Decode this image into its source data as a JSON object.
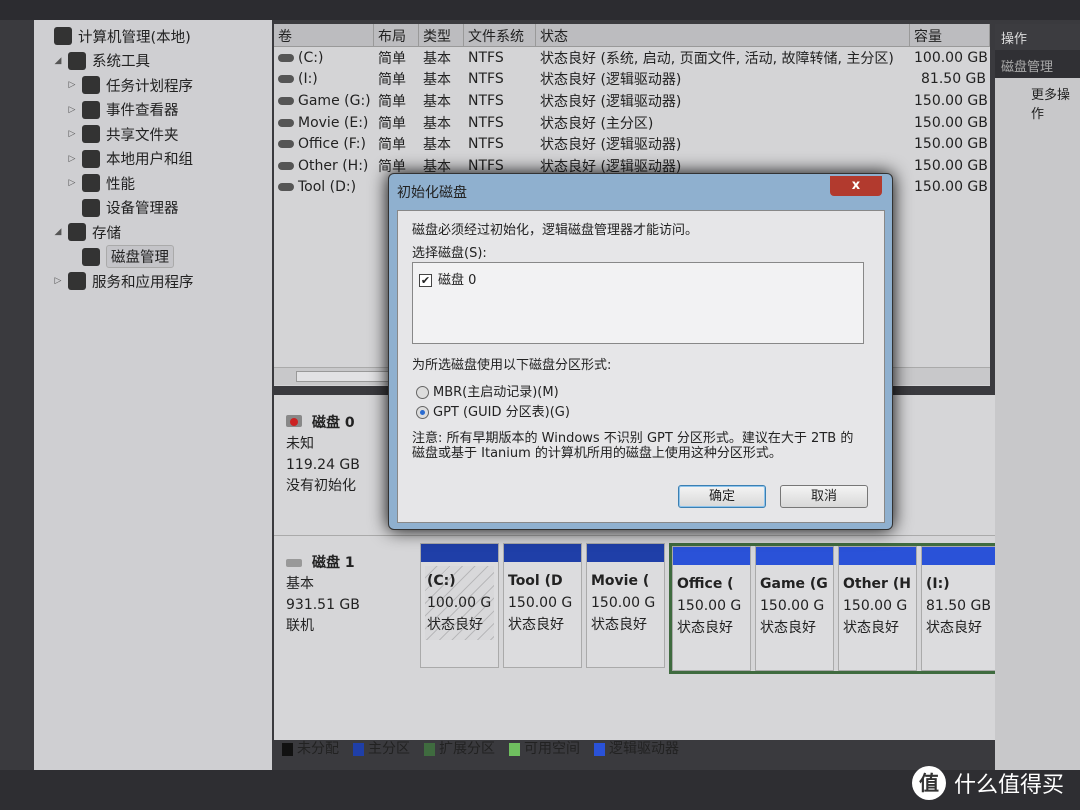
{
  "tree": {
    "items": [
      {
        "label": "计算机管理(本地)",
        "level": 0,
        "arrow": ""
      },
      {
        "label": "系统工具",
        "level": 1,
        "arrow": "expanded"
      },
      {
        "label": "任务计划程序",
        "level": 2,
        "arrow": "collapsed"
      },
      {
        "label": "事件查看器",
        "level": 2,
        "arrow": "collapsed"
      },
      {
        "label": "共享文件夹",
        "level": 2,
        "arrow": "collapsed"
      },
      {
        "label": "本地用户和组",
        "level": 2,
        "arrow": "collapsed"
      },
      {
        "label": "性能",
        "level": 2,
        "arrow": "collapsed"
      },
      {
        "label": "设备管理器",
        "level": 2,
        "arrow": ""
      },
      {
        "label": "存储",
        "level": 1,
        "arrow": "expanded"
      },
      {
        "label": "磁盘管理",
        "level": 2,
        "arrow": "",
        "selected": true
      },
      {
        "label": "服务和应用程序",
        "level": 1,
        "arrow": "collapsed"
      }
    ]
  },
  "volumes": {
    "headers": [
      "卷",
      "布局",
      "类型",
      "文件系统",
      "状态",
      "容量"
    ],
    "rows": [
      [
        "(C:)",
        "简单",
        "基本",
        "NTFS",
        "状态良好 (系统, 启动, 页面文件, 活动, 故障转储, 主分区)",
        "100.00 GB"
      ],
      [
        "(I:)",
        "简单",
        "基本",
        "NTFS",
        "状态良好 (逻辑驱动器)",
        "81.50 GB"
      ],
      [
        "Game (G:)",
        "简单",
        "基本",
        "NTFS",
        "状态良好 (逻辑驱动器)",
        "150.00 GB"
      ],
      [
        "Movie (E:)",
        "简单",
        "基本",
        "NTFS",
        "状态良好 (主分区)",
        "150.00 GB"
      ],
      [
        "Office (F:)",
        "简单",
        "基本",
        "NTFS",
        "状态良好 (逻辑驱动器)",
        "150.00 GB"
      ],
      [
        "Other (H:)",
        "简单",
        "基本",
        "NTFS",
        "状态良好 (逻辑驱动器)",
        "150.00 GB"
      ],
      [
        "Tool (D:)",
        "",
        "",
        "",
        "",
        "150.00 GB"
      ]
    ]
  },
  "disks": [
    {
      "name": "磁盘 0",
      "type": "未知",
      "size": "119.24 GB",
      "state": "没有初始化"
    },
    {
      "name": "磁盘 1",
      "type": "基本",
      "size": "931.51 GB",
      "state": "联机"
    }
  ],
  "partitions": {
    "primary": [
      {
        "name": "(C:)",
        "size": "100.00 G",
        "status": "状态良好",
        "hatched": true
      },
      {
        "name": "Tool (D",
        "size": "150.00 G",
        "status": "状态良好"
      },
      {
        "name": "Movie (",
        "size": "150.00 G",
        "status": "状态良好"
      }
    ],
    "logical": [
      {
        "name": "Office (",
        "size": "150.00 G",
        "status": "状态良好"
      },
      {
        "name": "Game (G",
        "size": "150.00 G",
        "status": "状态良好"
      },
      {
        "name": "Other (H",
        "size": "150.00 G",
        "status": "状态良好"
      },
      {
        "name": "(I:)",
        "size": "81.50 GB",
        "status": "状态良好"
      }
    ]
  },
  "legend": [
    {
      "label": "未分配",
      "color": "#111111"
    },
    {
      "label": "主分区",
      "color": "#1f3fa8"
    },
    {
      "label": "扩展分区",
      "color": "#3f6b3f"
    },
    {
      "label": "可用空间",
      "color": "#6fbf5f"
    },
    {
      "label": "逻辑驱动器",
      "color": "#2a52d8"
    }
  ],
  "actions": {
    "header": "操作",
    "section": "磁盘管理",
    "more": "更多操作"
  },
  "dialog": {
    "title": "初始化磁盘",
    "close": "x",
    "intro": "磁盘必须经过初始化，逻辑磁盘管理器才能访问。",
    "select_label": "选择磁盘(S):",
    "disk_item": "磁盘 0",
    "disk_checked": true,
    "style_label": "为所选磁盘使用以下磁盘分区形式:",
    "mbr": "MBR(主启动记录)(M)",
    "gpt": "GPT (GUID 分区表)(G)",
    "selected_style": "GPT",
    "note": "注意: 所有早期版本的 Windows 不识别 GPT 分区形式。建议在大于 2TB 的磁盘或基于 Itanium 的计算机所用的磁盘上使用这种分区形式。",
    "ok": "确定",
    "cancel": "取消"
  },
  "watermark": {
    "logo": "值",
    "text": "什么值得买"
  }
}
